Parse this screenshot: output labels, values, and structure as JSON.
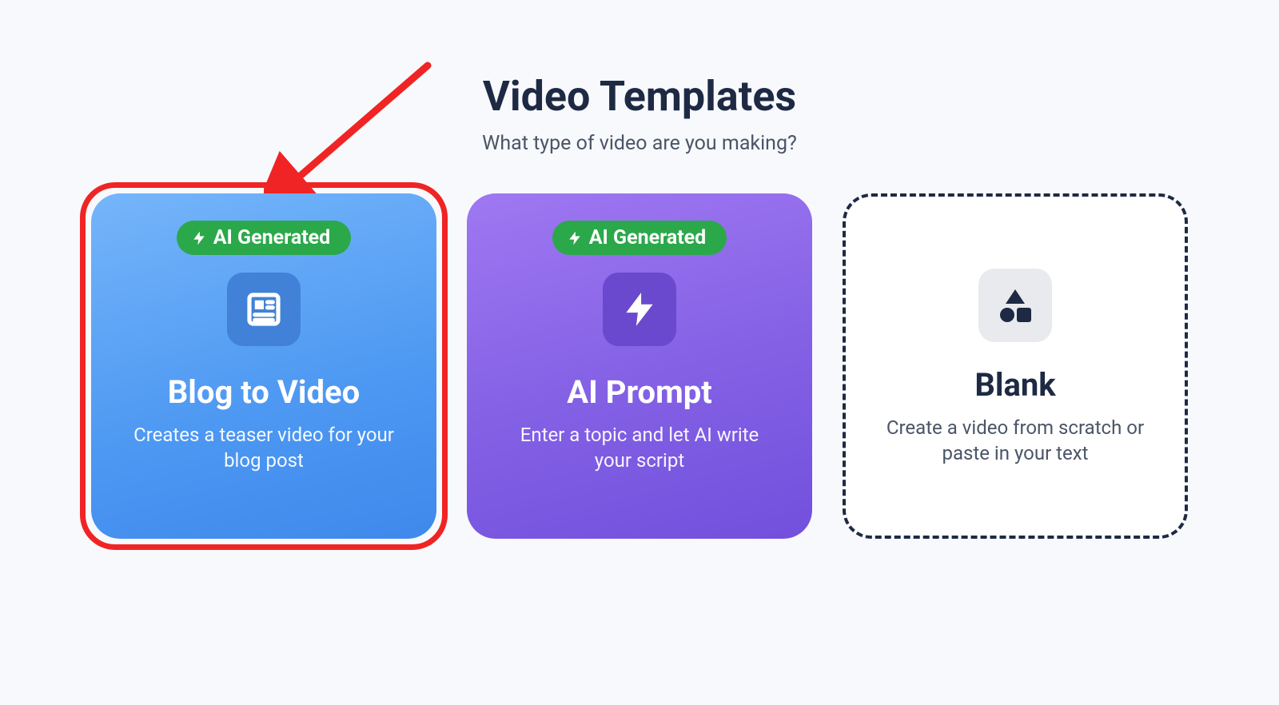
{
  "header": {
    "title": "Video Templates",
    "subtitle": "What type of video are you making?"
  },
  "cards": [
    {
      "badge": "AI Generated",
      "title": "Blog to Video",
      "desc": "Creates a teaser video for your blog post"
    },
    {
      "badge": "AI Generated",
      "title": "AI Prompt",
      "desc": "Enter a topic and let AI write your script"
    },
    {
      "title": "Blank",
      "desc": "Create a video from scratch or paste in your text"
    }
  ],
  "colors": {
    "highlight": "#f02424",
    "badge": "#2ba84a",
    "dark": "#1e2a44"
  }
}
